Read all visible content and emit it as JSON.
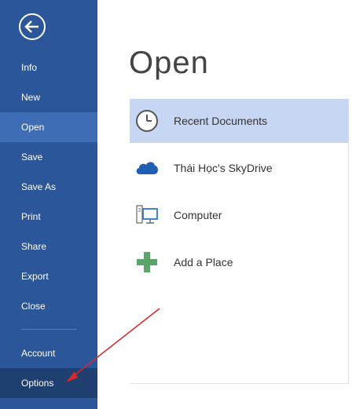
{
  "sidebar": {
    "back_icon": "back-arrow-icon",
    "items": [
      {
        "label": "Info"
      },
      {
        "label": "New"
      },
      {
        "label": "Open"
      },
      {
        "label": "Save"
      },
      {
        "label": "Save As"
      },
      {
        "label": "Print"
      },
      {
        "label": "Share"
      },
      {
        "label": "Export"
      },
      {
        "label": "Close"
      },
      {
        "label": "Account"
      },
      {
        "label": "Options"
      }
    ],
    "active_item": "Open"
  },
  "main": {
    "title": "Open",
    "places": [
      {
        "label": "Recent Documents",
        "icon": "clock-icon",
        "selected": true
      },
      {
        "label": "Thái Học's SkyDrive",
        "icon": "cloud-icon",
        "selected": false
      },
      {
        "label": "Computer",
        "icon": "computer-icon",
        "selected": false
      },
      {
        "label": "Add a Place",
        "icon": "plus-icon",
        "selected": false
      }
    ]
  },
  "colors": {
    "sidebar_bg": "#2b579a",
    "sidebar_active": "#3e6db5",
    "selected_place": "#c7d6f2",
    "arrow": "#d9262c",
    "plus_green": "#5ba46a",
    "cloud_blue": "#1f5fb5"
  }
}
